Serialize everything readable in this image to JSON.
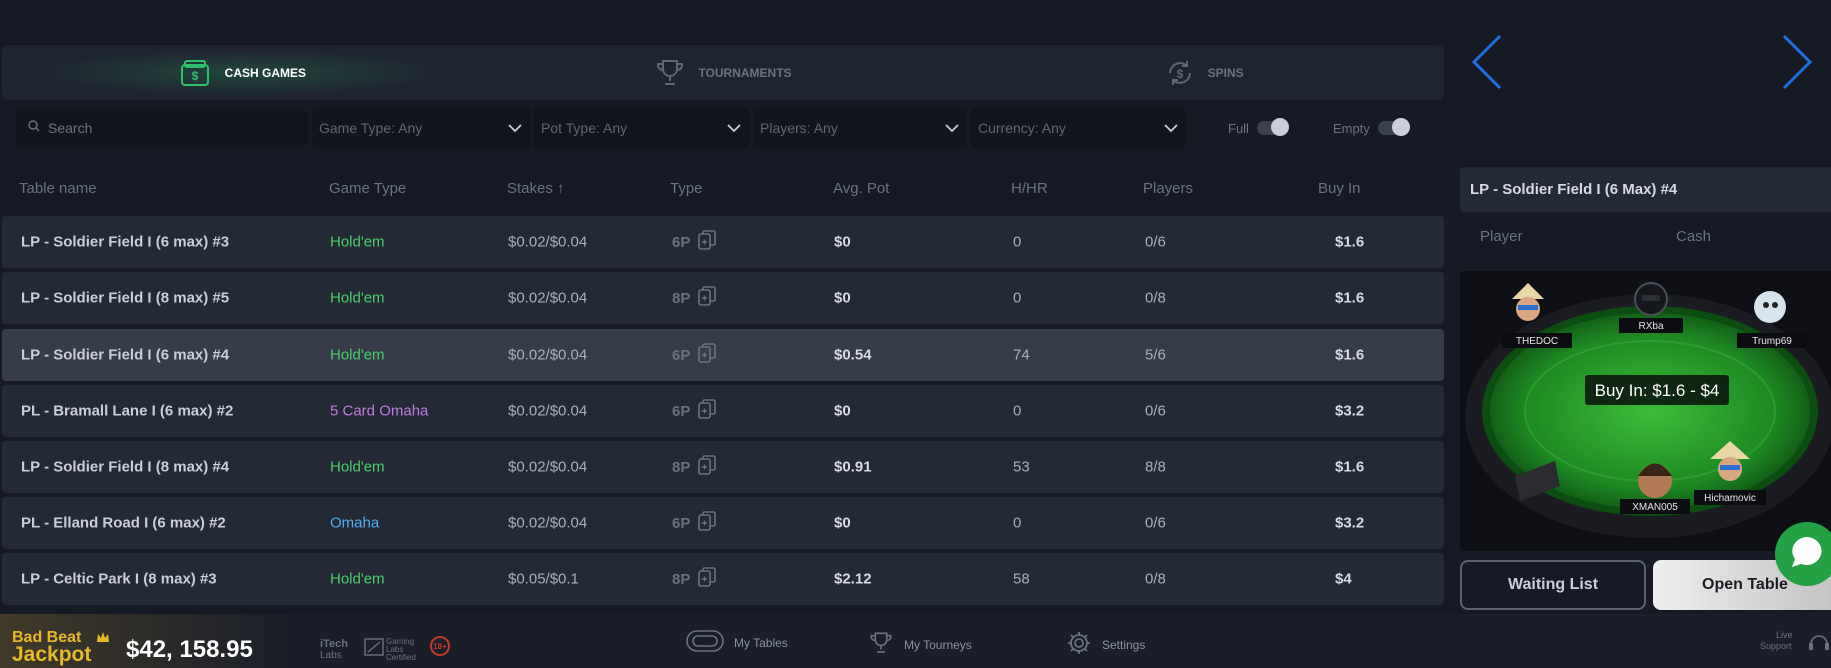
{
  "tabs": [
    {
      "label": "CASH GAMES",
      "icon": "cash-icon",
      "active": true
    },
    {
      "label": "TOURNAMENTS",
      "icon": "trophy-icon",
      "active": false
    },
    {
      "label": "SPINS",
      "icon": "spins-icon",
      "active": false
    }
  ],
  "filters": {
    "search_placeholder": "Search",
    "game_type": "Game Type: Any",
    "pot_type": "Pot Type: Any",
    "players": "Players: Any",
    "currency": "Currency: Any",
    "full_label": "Full",
    "empty_label": "Empty"
  },
  "table": {
    "headers": [
      "Table name",
      "Game Type",
      "Stakes ↑",
      "Type",
      "Avg. Pot",
      "H/HR",
      "Players",
      "Buy In"
    ],
    "rows": [
      {
        "name": "LP - Soldier Field I (6 max) #3",
        "game": "Hold'em",
        "stakes": "$0.02/$0.04",
        "type": "6P",
        "avg": "$0",
        "hhr": "0",
        "players": "0/6",
        "buyin": "$1.6"
      },
      {
        "name": "LP - Soldier Field I (8 max) #5",
        "game": "Hold'em",
        "stakes": "$0.02/$0.04",
        "type": "8P",
        "avg": "$0",
        "hhr": "0",
        "players": "0/8",
        "buyin": "$1.6"
      },
      {
        "name": "LP - Soldier Field I (6 max) #4",
        "game": "Hold'em",
        "stakes": "$0.02/$0.04",
        "type": "6P",
        "avg": "$0.54",
        "hhr": "74",
        "players": "5/6",
        "buyin": "$1.6"
      },
      {
        "name": "PL - Bramall Lane I (6 max) #2",
        "game": "5 Card Omaha",
        "stakes": "$0.02/$0.04",
        "type": "6P",
        "avg": "$0",
        "hhr": "0",
        "players": "0/6",
        "buyin": "$3.2"
      },
      {
        "name": "LP - Soldier Field I (8 max) #4",
        "game": "Hold'em",
        "stakes": "$0.02/$0.04",
        "type": "8P",
        "avg": "$0.91",
        "hhr": "53",
        "players": "8/8",
        "buyin": "$1.6"
      },
      {
        "name": "PL - Elland Road I (6 max) #2",
        "game": "Omaha",
        "stakes": "$0.02/$0.04",
        "type": "6P",
        "avg": "$0",
        "hhr": "0",
        "players": "0/6",
        "buyin": "$3.2"
      },
      {
        "name": "LP - Celtic Park I (8 max) #3",
        "game": "Hold'em",
        "stakes": "$0.05/$0.1",
        "type": "8P",
        "avg": "$2.12",
        "hhr": "58",
        "players": "0/8",
        "buyin": "$4"
      }
    ],
    "selected_index": 2
  },
  "game_colors": {
    "Hold'em": "#46d16a",
    "5 Card Omaha": "#c07ce0",
    "Omaha": "#4fb0ea"
  },
  "panel": {
    "title": "LP - Soldier Field I (6 Max) #4",
    "col_player": "Player",
    "col_cash": "Cash",
    "buyin_badge": "Buy In: $1.6 - $4",
    "seats": [
      "THEDOC",
      "RXba",
      "Trump69",
      "XMAN005",
      "Hichamovic"
    ],
    "waiting_list": "Waiting List",
    "open_table": "Open Table"
  },
  "footer": {
    "jackpot_line1": "Bad Beat",
    "jackpot_line2": "Jackpot",
    "jackpot_amount": "$42, 158.95",
    "itech_1": "iTech",
    "itech_2": "Labs",
    "gaming_1": "Gaming",
    "gaming_2": "Labs",
    "gaming_3": "Certified",
    "age": "18+",
    "my_tables": "My Tables",
    "my_tourneys": "My Tourneys",
    "settings": "Settings",
    "live_support_1": "Live",
    "live_support_2": "Support"
  },
  "accent": "#1e6fe0"
}
